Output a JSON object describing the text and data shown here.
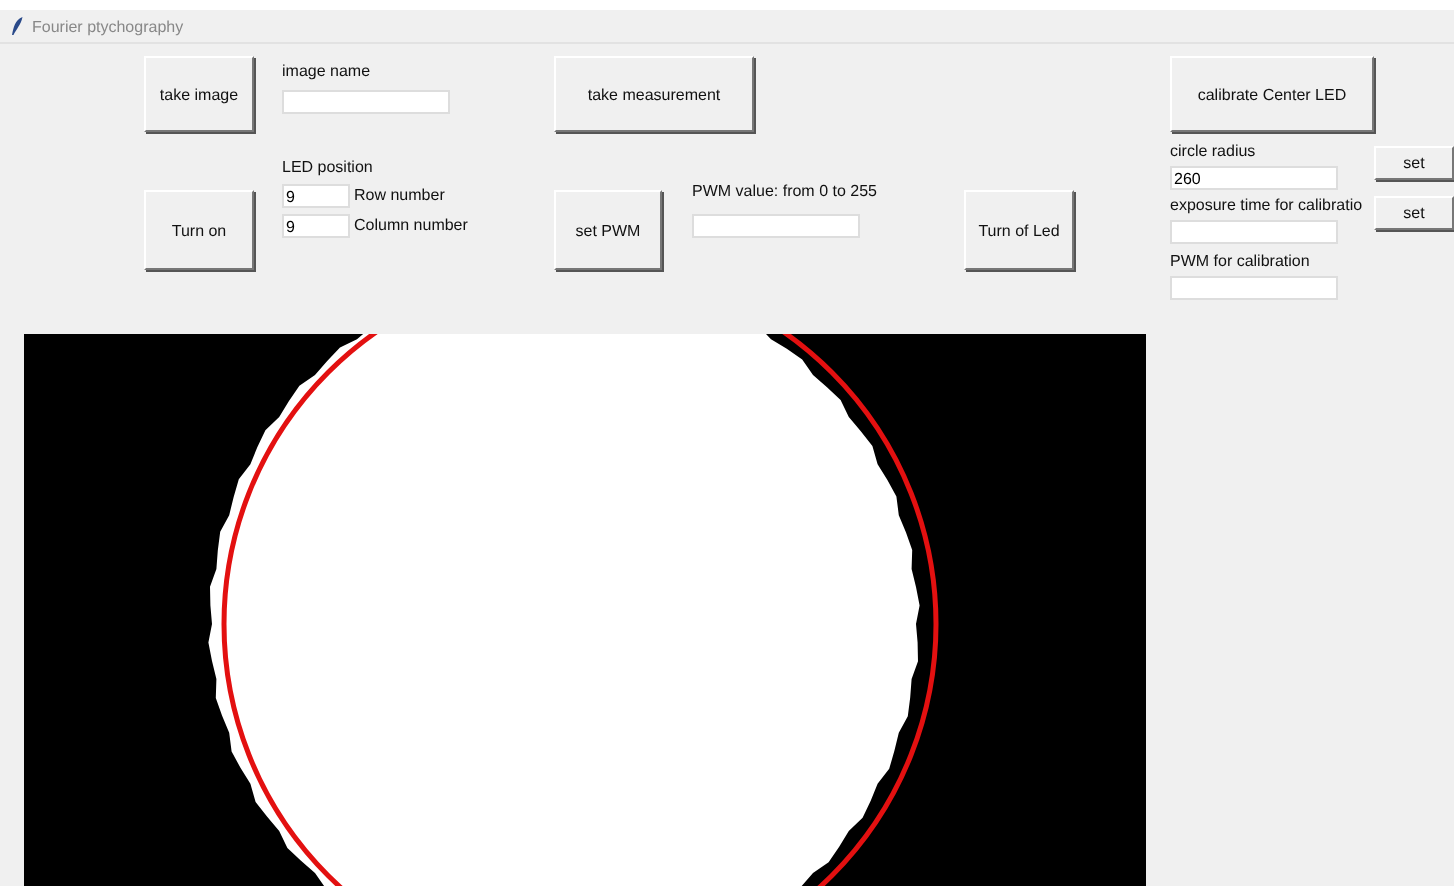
{
  "window": {
    "title": "Fourier ptychography"
  },
  "buttons": {
    "take_image": "take image",
    "turn_on": "Turn on",
    "take_measurement": "take measurement",
    "set_pwm": "set PWM",
    "turn_off_led": "Turn of Led",
    "calibrate": "calibrate Center LED",
    "set_radius": "set",
    "set_exposure": "set"
  },
  "image_name": {
    "label": "image name"
  },
  "led_position": {
    "label": "LED position",
    "row": {
      "value": "9",
      "label": "Row number"
    },
    "column": {
      "value": "9",
      "label": "Column number"
    }
  },
  "pwm": {
    "label": "PWM value: from 0 to 255"
  },
  "calibration": {
    "circle_radius": {
      "label": "circle radius",
      "value": "260"
    },
    "exposure_time": {
      "label": "exposure time for calibratio"
    },
    "pwm": {
      "label": "PWM for calibration"
    }
  }
}
